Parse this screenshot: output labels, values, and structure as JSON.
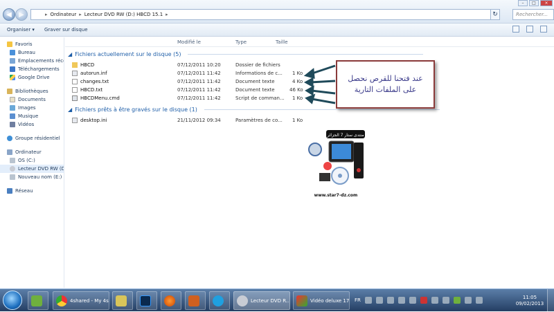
{
  "address": {
    "parts": [
      "Ordinateur",
      "Lecteur DVD RW (D:) HBCD 15.1"
    ],
    "search_placeholder": "Rechercher..."
  },
  "toolbar": {
    "organize": "Organiser ▾",
    "burn": "Graver sur disque"
  },
  "sidebar": {
    "favorites": "Favoris",
    "favorites_items": [
      "Bureau",
      "Emplacements récents",
      "Téléchargements",
      "Google Drive"
    ],
    "libraries": "Bibliothèques",
    "libraries_items": [
      "Documents",
      "Images",
      "Musique",
      "Vidéos"
    ],
    "homegroup": "Groupe résidentiel",
    "computer": "Ordinateur",
    "computer_items": [
      "OS (C:)",
      "Lecteur DVD RW (D:)",
      "Nouveau nom (E:)"
    ],
    "network": "Réseau"
  },
  "columns": {
    "modified": "Modifié le",
    "type": "Type",
    "size": "Taille"
  },
  "groups": {
    "current": "Fichiers actuellement sur le disque (5)",
    "ready": "Fichiers prêts à être gravés sur le disque (1)"
  },
  "files_current": [
    {
      "name": "HBCD",
      "date": "07/12/2011 10:20",
      "type": "Dossier de fichiers",
      "size": ""
    },
    {
      "name": "autorun.inf",
      "date": "07/12/2011 11:42",
      "type": "Informations de c...",
      "size": "1 Ko"
    },
    {
      "name": "changes.txt",
      "date": "07/12/2011 11:42",
      "type": "Document texte",
      "size": "4 Ko"
    },
    {
      "name": "HBCD.txt",
      "date": "07/12/2011 11:42",
      "type": "Document texte",
      "size": "46 Ko"
    },
    {
      "name": "HBCDMenu.cmd",
      "date": "07/12/2011 11:42",
      "type": "Script de comman...",
      "size": "1 Ko"
    }
  ],
  "files_ready": [
    {
      "name": "desktop.ini",
      "date": "21/11/2012 09:34",
      "type": "Paramètres de co...",
      "size": "1 Ko"
    }
  ],
  "callout": {
    "line1": "عند فتحنا للقرص نحصل",
    "line2": "على الملفات التارية"
  },
  "logo": {
    "banner": "منتدى ستار 7 الجزائر",
    "url": "www.star7-dz.com"
  },
  "taskbar": {
    "items": [
      "4shared - My 4s...",
      "Lecteur DVD R...",
      "Vidéo deluxe 17..."
    ],
    "lang": "FR",
    "time": "11:05",
    "date": "09/02/2013"
  }
}
